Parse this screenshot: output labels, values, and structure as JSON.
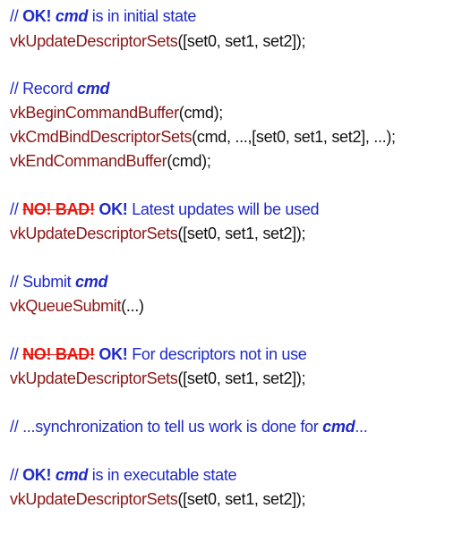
{
  "colors": {
    "comment": "#1f2ac8",
    "bad": "#e8150c",
    "function": "#8a1616",
    "text": "#111111",
    "background": "#ffffff"
  },
  "blocks": [
    {
      "comment": {
        "prefix": "// ",
        "ok": "OK!",
        "cmd": "cmd",
        "rest": " is in initial state"
      },
      "code": [
        {
          "fn": "vkUpdateDescriptorSets",
          "args": "([set0, set1, set2]);"
        }
      ]
    },
    {
      "comment": {
        "prefix": "// Record ",
        "cmd": "cmd"
      },
      "code": [
        {
          "fn": "vkBeginCommandBuffer",
          "args": "(cmd);"
        },
        {
          "fn": "vkCmdBindDescriptorSets",
          "args": "(cmd, ...,[set0, set1, set2], ...);"
        },
        {
          "fn": "vkEndCommandBuffer",
          "args": "(cmd);"
        }
      ]
    },
    {
      "comment": {
        "prefix": "// ",
        "bad": "NO! BAD!",
        "ok": "OK!",
        "rest": "Latest updates will be used"
      },
      "code": [
        {
          "fn": "vkUpdateDescriptorSets",
          "args": "([set0, set1, set2]);"
        }
      ]
    },
    {
      "comment": {
        "prefix": "// Submit ",
        "cmd": "cmd"
      },
      "code": [
        {
          "fn": "vkQueueSubmit",
          "args": "(...)"
        }
      ]
    },
    {
      "comment": {
        "prefix": "// ",
        "bad": "NO! BAD!",
        "ok": "OK!",
        "rest": "For descriptors not in use"
      },
      "code": [
        {
          "fn": "vkUpdateDescriptorSets",
          "args": "([set0, set1, set2]);"
        }
      ]
    },
    {
      "comment": {
        "prefix": "// ...synchronization to tell us work is done for ",
        "cmd": "cmd",
        "suffix": "..."
      }
    },
    {
      "comment": {
        "prefix": "// ",
        "ok": "OK!",
        "cmd": "cmd",
        "rest": " is in executable state"
      },
      "code": [
        {
          "fn": "vkUpdateDescriptorSets",
          "args": "([set0, set1, set2]);"
        }
      ]
    }
  ]
}
